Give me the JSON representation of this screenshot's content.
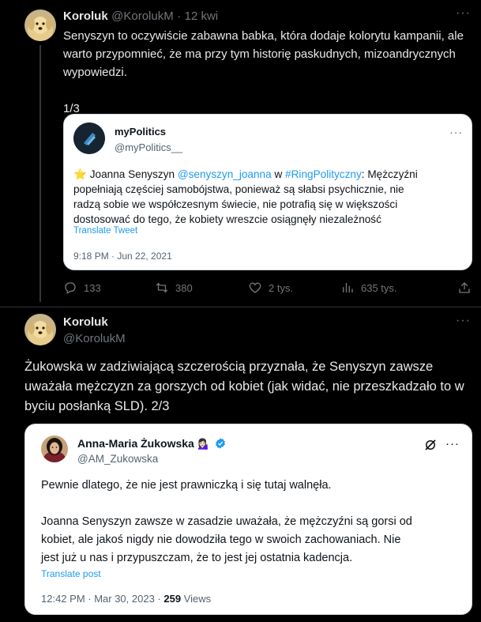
{
  "tweet1": {
    "author_name": "Koroluk",
    "handle": "@KorolukM",
    "separator": "·",
    "time": "12 kwi",
    "text_line1": "Senyszyn to oczywiście zabawna babka, która dodaje kolorytu kampanii, ale",
    "text_line2": "warto przypomnieć, że ma przy tym historię paskudnych, mizoandrycznych",
    "text_line3": "wypowiedzi.",
    "counter": "1/3",
    "quote": {
      "author_name": "myPolitics",
      "handle": "@myPolitics__",
      "star": "⭐",
      "text_pre": " Joanna Senyszyn ",
      "mention": "@senyszyn_joanna",
      "text_mid": " w ",
      "hashtag": "#RingPolityczny",
      "text_post": ": Mężczyźni",
      "line2": "popełniają częściej samobójstwa, ponieważ są słabsi psychicznie, nie",
      "line3": "radzą sobie we współczesnym świecie, nie potrafią się w większości",
      "line4": "dostosować do tego, że kobiety wreszcie osiągnęły niezależność",
      "translate": "Translate Tweet",
      "timestamp": "9:18 PM · Jun 22, 2021"
    },
    "actions": {
      "replies": "133",
      "reposts": "380",
      "likes": "2 tys.",
      "views": "635 tys."
    }
  },
  "tweet2": {
    "author_name": "Koroluk",
    "handle": "@KorolukM",
    "text_line1": "Żukowska w zadziwiającą szczerością przyznała, że Senyszyn zawsze",
    "text_line2": "uważała mężczyzn za gorszych od kobiet (jak widać, nie przeszkadzało to w",
    "text_line3": "byciu posłanką SLD). 2/3",
    "quote": {
      "author_name": "Anna-Maria Żukowska",
      "emoji": "💁🏻‍♀️",
      "handle": "@AM_Zukowska",
      "para1": "Pewnie dlatego, że nie jest prawniczką i się tutaj walnęła.",
      "para2_line1": "Joanna Senyszyn zawsze w zasadzie uważała, że mężczyźni są gorsi od",
      "para2_line2": "kobiet, ale jakoś nigdy nie dowodziła tego w swoich zachowaniach. Nie",
      "para2_line3": "jest już u nas i przypuszczam, że to jest jej ostatnia kadencja.",
      "translate": "Translate post",
      "timestamp": "12:42 PM · Mar 30, 2023 · ",
      "views_count": "259",
      "views_label": " Views"
    }
  },
  "icons": {
    "more": "more-icon",
    "reply": "reply-icon",
    "repost": "repost-icon",
    "like": "heart-icon",
    "views": "views-icon",
    "share": "share-icon",
    "verified": "verified-badge-icon",
    "grok": "grok-icon"
  },
  "colors": {
    "background": "#000000",
    "accent": "#1d9bf0",
    "muted": "#71767b",
    "verified": "#1d9bf0"
  }
}
